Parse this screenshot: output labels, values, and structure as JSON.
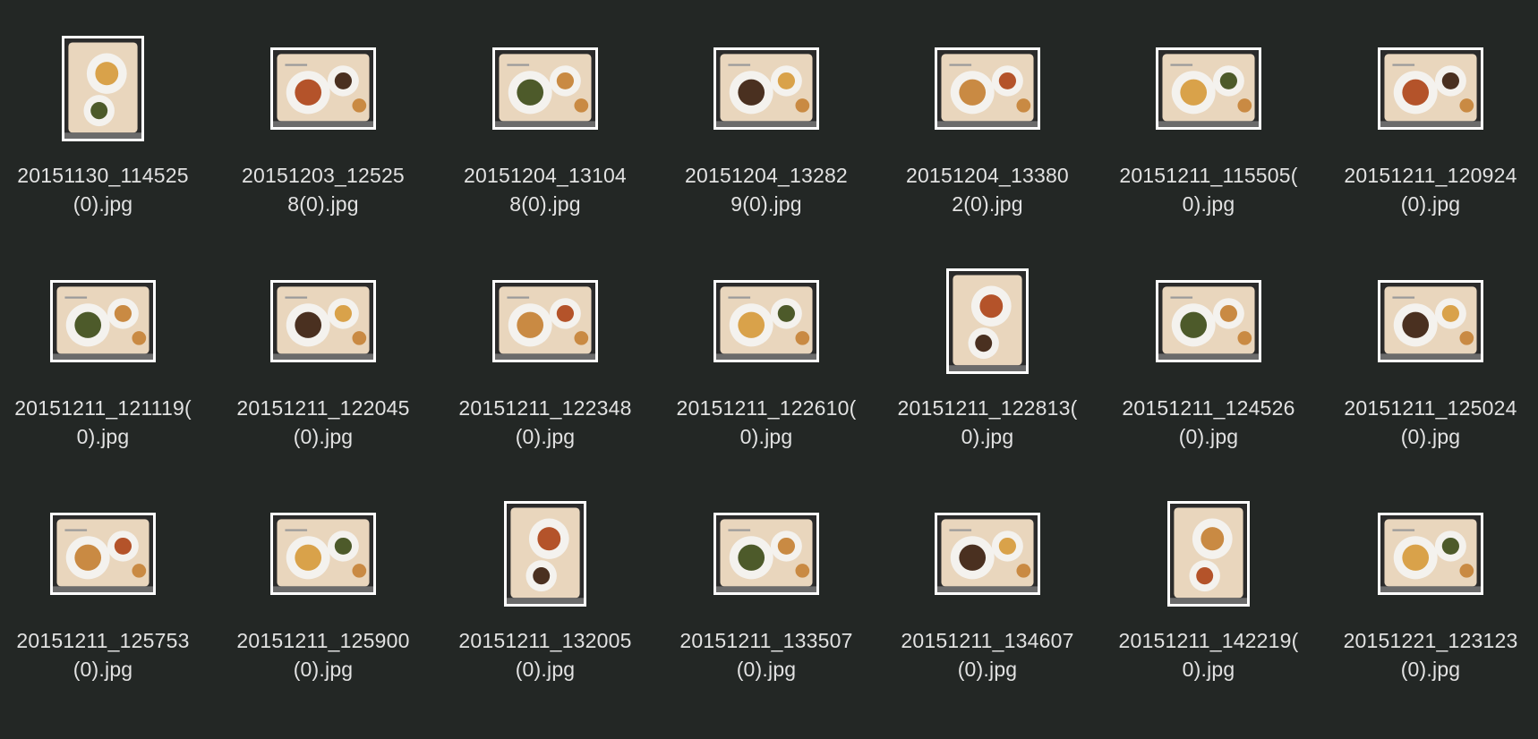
{
  "files": [
    {
      "name": "20151130_114525(0).jpg",
      "line1": "20151130_114525",
      "line2": "(0).jpg",
      "orientation": "portrait"
    },
    {
      "name": "20151203_125258(0).jpg",
      "line1": "20151203_12525",
      "line2": "8(0).jpg",
      "orientation": "landscape"
    },
    {
      "name": "20151204_131048(0).jpg",
      "line1": "20151204_13104",
      "line2": "8(0).jpg",
      "orientation": "landscape"
    },
    {
      "name": "20151204_132829(0).jpg",
      "line1": "20151204_13282",
      "line2": "9(0).jpg",
      "orientation": "landscape"
    },
    {
      "name": "20151204_133802(0).jpg",
      "line1": "20151204_13380",
      "line2": "2(0).jpg",
      "orientation": "landscape"
    },
    {
      "name": "20151211_115505(0).jpg",
      "line1": "20151211_115505(",
      "line2": "0).jpg",
      "orientation": "landscape"
    },
    {
      "name": "20151211_120924(0).jpg",
      "line1": "20151211_120924",
      "line2": "(0).jpg",
      "orientation": "landscape"
    },
    {
      "name": "20151211_121119(0).jpg",
      "line1": "20151211_121119(",
      "line2": "0).jpg",
      "orientation": "landscape"
    },
    {
      "name": "20151211_122045(0).jpg",
      "line1": "20151211_122045",
      "line2": "(0).jpg",
      "orientation": "landscape"
    },
    {
      "name": "20151211_122348(0).jpg",
      "line1": "20151211_122348",
      "line2": "(0).jpg",
      "orientation": "landscape"
    },
    {
      "name": "20151211_122610(0).jpg",
      "line1": "20151211_122610(",
      "line2": "0).jpg",
      "orientation": "landscape"
    },
    {
      "name": "20151211_122813(0).jpg",
      "line1": "20151211_122813(",
      "line2": "0).jpg",
      "orientation": "portrait"
    },
    {
      "name": "20151211_124526(0).jpg",
      "line1": "20151211_124526",
      "line2": "(0).jpg",
      "orientation": "landscape"
    },
    {
      "name": "20151211_125024(0).jpg",
      "line1": "20151211_125024",
      "line2": "(0).jpg",
      "orientation": "landscape"
    },
    {
      "name": "20151211_125753(0).jpg",
      "line1": "20151211_125753",
      "line2": "(0).jpg",
      "orientation": "landscape"
    },
    {
      "name": "20151211_125900(0).jpg",
      "line1": "20151211_125900",
      "line2": "(0).jpg",
      "orientation": "landscape"
    },
    {
      "name": "20151211_132005(0).jpg",
      "line1": "20151211_132005",
      "line2": "(0).jpg",
      "orientation": "portrait"
    },
    {
      "name": "20151211_133507(0).jpg",
      "line1": "20151211_133507",
      "line2": "(0).jpg",
      "orientation": "landscape"
    },
    {
      "name": "20151211_134607(0).jpg",
      "line1": "20151211_134607",
      "line2": "(0).jpg",
      "orientation": "landscape"
    },
    {
      "name": "20151211_142219(0).jpg",
      "line1": "20151211_142219(",
      "line2": "0).jpg",
      "orientation": "portrait"
    },
    {
      "name": "20151221_123123(0).jpg",
      "line1": "20151221_123123",
      "line2": "(0).jpg",
      "orientation": "landscape"
    }
  ],
  "colors": {
    "background": "#232725",
    "label_text": "#e2e2e2",
    "thumb_border": "#ffffff",
    "tray": "#e9d6bd",
    "plate": "#f4f2ee",
    "food_pasta": "#d9a24a",
    "food_sauce": "#b4532a",
    "food_greens": "#4d5a2a",
    "food_bread": "#c98a43",
    "food_dark": "#4a3020"
  }
}
